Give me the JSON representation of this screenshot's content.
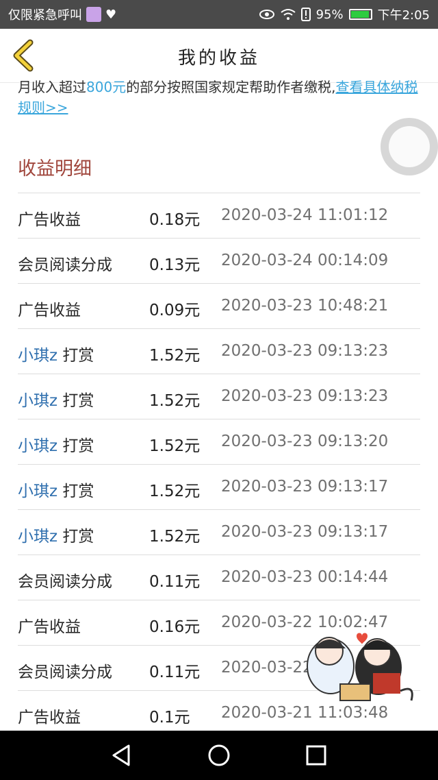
{
  "status_bar": {
    "left_text": "仅限紧急呼叫",
    "battery": "95%",
    "time": "下午2:05",
    "icons": [
      "sticker-emoji-icon",
      "heart-pulse-icon",
      "eye-icon",
      "wifi-icon",
      "alert-icon",
      "battery-icon"
    ]
  },
  "header": {
    "title": "我的收益",
    "back_icon": "back-chevron-icon"
  },
  "notice": {
    "prefix": "月收入超过",
    "amount": "800元",
    "middle": "的部分按照国家规定帮助作者缴税,",
    "link": "查看具体纳税规则>>"
  },
  "section_title": "收益明细",
  "rows": [
    {
      "type": "广告收益",
      "user": "",
      "amount": "0.18元",
      "time": "2020-03-24 11:01:12"
    },
    {
      "type": "会员阅读分成",
      "user": "",
      "amount": "0.13元",
      "time": "2020-03-24 00:14:09"
    },
    {
      "type": "广告收益",
      "user": "",
      "amount": "0.09元",
      "time": "2020-03-23 10:48:21"
    },
    {
      "type": " 打赏",
      "user": "小琪z",
      "amount": "1.52元",
      "time": "2020-03-23 09:13:23"
    },
    {
      "type": " 打赏",
      "user": "小琪z",
      "amount": "1.52元",
      "time": "2020-03-23 09:13:23"
    },
    {
      "type": " 打赏",
      "user": "小琪z",
      "amount": "1.52元",
      "time": "2020-03-23 09:13:20"
    },
    {
      "type": " 打赏",
      "user": "小琪z",
      "amount": "1.52元",
      "time": "2020-03-23 09:13:17"
    },
    {
      "type": " 打赏",
      "user": "小琪z",
      "amount": "1.52元",
      "time": "2020-03-23 09:13:17"
    },
    {
      "type": "会员阅读分成",
      "user": "",
      "amount": "0.11元",
      "time": "2020-03-23 00:14:44"
    },
    {
      "type": "广告收益",
      "user": "",
      "amount": "0.16元",
      "time": "2020-03-22 10:02:47"
    },
    {
      "type": "会员阅读分成",
      "user": "",
      "amount": "0.11元",
      "time": "2020-03-22"
    },
    {
      "type": "广告收益",
      "user": "",
      "amount": "0.1元",
      "time": "2020-03-21 11:03:48"
    }
  ],
  "nav": {
    "icons": [
      "back-triangle-icon",
      "home-circle-icon",
      "recents-square-icon"
    ]
  },
  "colors": {
    "accent_link": "#3aa6dc",
    "section_title": "#a0463c",
    "user_name": "#2f6fae",
    "status_bar_bg": "#4a4a4a"
  }
}
